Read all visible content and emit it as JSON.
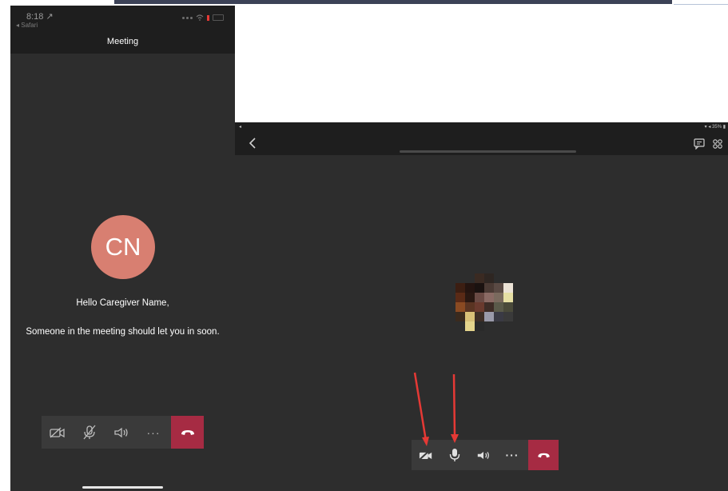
{
  "phone": {
    "status_time": "8:18 ↗",
    "status_back": "◂ Safari",
    "title": "Meeting",
    "avatar_initials": "CN",
    "greeting": "Hello Caregiver Name,",
    "waiting_message": "Someone in the meeting should let you in soon.",
    "more_label": "···",
    "controls": [
      "video-off-icon",
      "mic-off-icon",
      "speaker-icon",
      "more-icon",
      "hang-up-icon"
    ]
  },
  "tablet": {
    "status_left": "◂",
    "status_right": "▾ ◂ 35% ▮",
    "more_label": "···",
    "header_icons": [
      "back-chevron-icon",
      "chat-icon",
      "participants-icon"
    ],
    "controls": [
      "video-off-icon",
      "mic-icon",
      "speaker-icon",
      "more-icon",
      "hang-up-icon"
    ]
  },
  "colors": {
    "background": "#2d2d2d",
    "header": "#1e1e1e",
    "control_bar": "#3a3a3a",
    "hang_up": "#a62b43",
    "avatar": "#d87f71",
    "annotation_arrow": "#e53935"
  }
}
